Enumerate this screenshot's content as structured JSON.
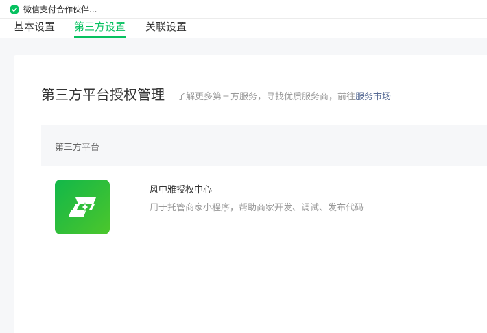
{
  "window": {
    "title": "微信支付合作伙伴..."
  },
  "tabs": [
    {
      "label": "基本设置",
      "active": false
    },
    {
      "label": "第三方设置",
      "active": true
    },
    {
      "label": "关联设置",
      "active": false
    }
  ],
  "section": {
    "title": "第三方平台授权管理",
    "description": "了解更多第三方服务，寻找优质服务商，前往",
    "link_label": "服务市场"
  },
  "table": {
    "header": "第三方平台",
    "rows": [
      {
        "name": "风中雅授权中心",
        "description": "用于托管商家小程序，帮助商家开发、调试、发布代码",
        "icon": "app-s-logo-icon"
      }
    ]
  },
  "colors": {
    "accent": "#07c160",
    "link": "#576b95",
    "icon_gradient_start": "#12b84a",
    "icon_gradient_end": "#4cc72c"
  }
}
